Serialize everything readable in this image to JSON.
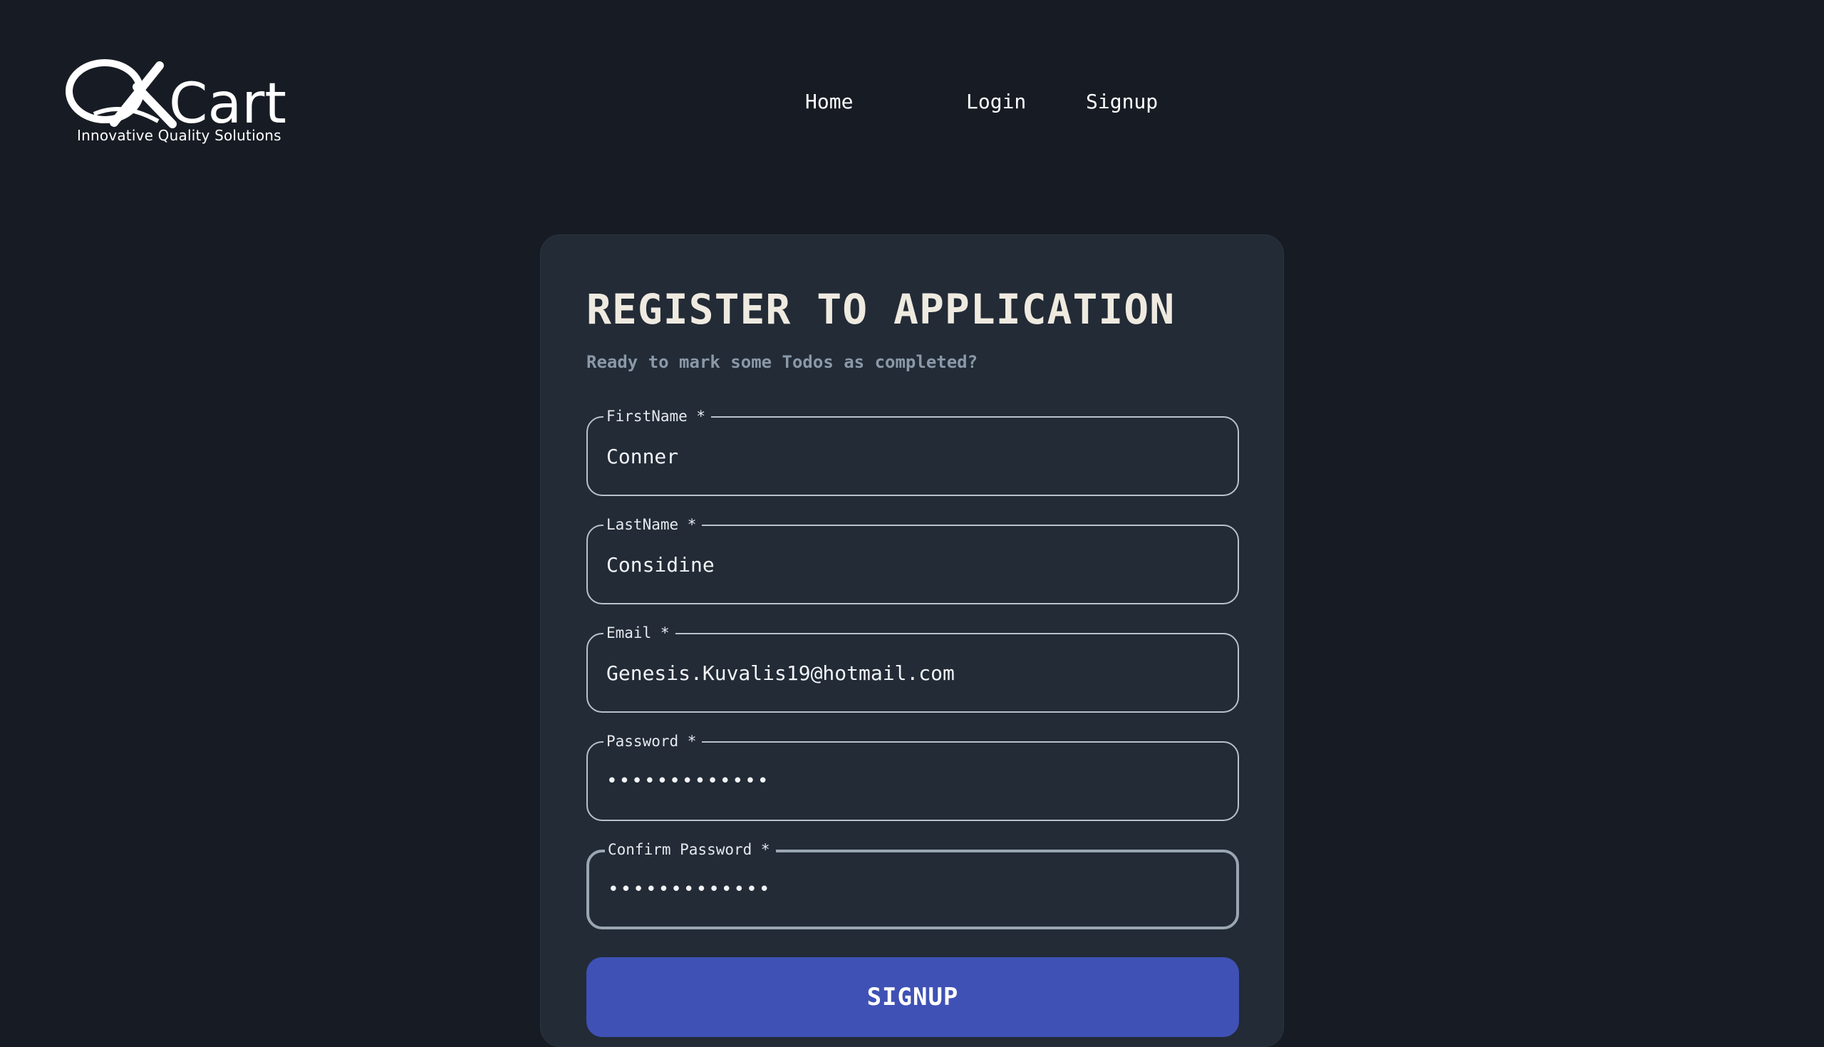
{
  "brand": {
    "logo_text": "QKart",
    "tagline": "Innovative Quality Solutions"
  },
  "nav": {
    "items": [
      "Home",
      "Login",
      "Signup"
    ]
  },
  "form": {
    "title": "REGISTER TO APPLICATION",
    "subtitle": "Ready to mark some Todos as completed?",
    "fields": [
      {
        "label": "FirstName *",
        "value": "Conner",
        "type": "text"
      },
      {
        "label": "LastName *",
        "value": "Considine",
        "type": "text"
      },
      {
        "label": "Email *",
        "value": "Genesis.Kuvalis19@hotmail.com",
        "type": "text"
      },
      {
        "label": "Password *",
        "value": "•••••••••••••",
        "type": "password"
      },
      {
        "label": "Confirm Password *",
        "value": "•••••••••••••",
        "type": "password"
      }
    ],
    "submit_label": "SIGNUP"
  },
  "colors": {
    "page_bg": "#171c24",
    "card_bg": "#222b36",
    "accent": "#3f51b5",
    "subtitle": "#8a98a8"
  }
}
